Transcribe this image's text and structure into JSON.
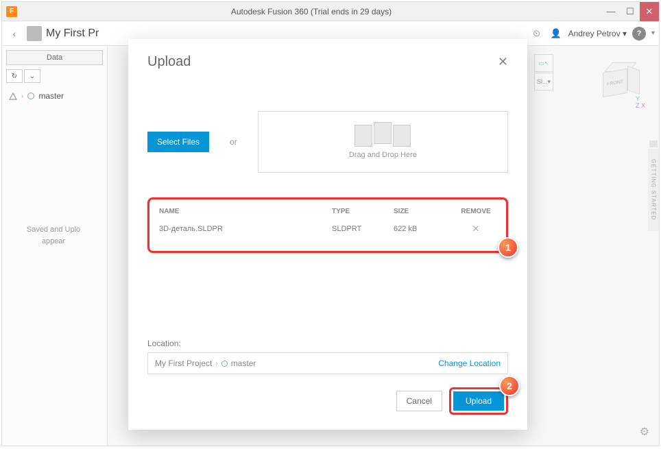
{
  "titlebar": {
    "icon_letter": "F",
    "title": "Autodesk Fusion 360 (Trial ends in 29 days)"
  },
  "topbar": {
    "project_title": "My First Pr",
    "user_name": "Andrey Petrov"
  },
  "sidepanel": {
    "data_tab": "Data",
    "tree_item": "master",
    "status_text1": "Saved and Uplo",
    "status_text2": "appear"
  },
  "canvas": {
    "mini_label": "Sl...",
    "cube_front": "FRONT",
    "rail_text": "GETTING STARTED"
  },
  "modal": {
    "title": "Upload",
    "select_files": "Select Files",
    "or": "or",
    "drop_text": "Drag and Drop Here",
    "col_name": "NAME",
    "col_type": "TYPE",
    "col_size": "SIZE",
    "col_remove": "REMOVE",
    "file_name": "3D-деталь.SLDPR",
    "file_type": "SLDPRT",
    "file_size": "622 kB",
    "location_label": "Location:",
    "loc_project": "My First Project",
    "loc_branch": "master",
    "change_location": "Change Location",
    "cancel": "Cancel",
    "upload": "Upload"
  },
  "callouts": {
    "one": "1",
    "two": "2"
  }
}
